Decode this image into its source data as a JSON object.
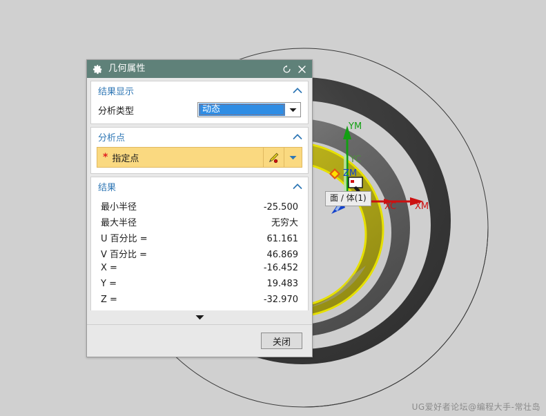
{
  "window": {
    "title": "几何属性",
    "gear_icon": "gear-icon",
    "reset_icon": "reset-icon",
    "close_icon": "close-icon"
  },
  "sections": {
    "result_display": {
      "header": "结果显示",
      "collapse_icon": "chevron-up-icon",
      "analysis_type_label": "分析类型",
      "analysis_type_value": "动态",
      "dropdown_icon": "chevron-down-icon"
    },
    "analysis_point": {
      "header": "分析点",
      "collapse_icon": "chevron-up-icon",
      "required_marker": "*",
      "field_label": "指定点",
      "point_constructor_icon": "point-constructor-icon",
      "dropdown_icon": "chevron-down-icon"
    },
    "results": {
      "header": "结果",
      "collapse_icon": "chevron-up-icon",
      "rows": [
        {
          "label": "最小半径",
          "value": "-25.500"
        },
        {
          "label": "最大半径",
          "value": "无穷大"
        },
        {
          "label": "U 百分比 =",
          "value": "61.161"
        },
        {
          "label": "V 百分比 =",
          "value": "46.869"
        },
        {
          "label": "X =",
          "value": "-16.452"
        },
        {
          "label": "Y =",
          "value": "19.483"
        },
        {
          "label": "Z =",
          "value": "-32.970"
        }
      ]
    }
  },
  "expander": {
    "icon": "chevron-down-icon"
  },
  "footer": {
    "close_label": "关闭"
  },
  "viewport": {
    "tooltip": "面 / 体(1)",
    "axes": [
      {
        "name": "XC",
        "color": "#c81010"
      },
      {
        "name": "XM",
        "color": "#c81010"
      },
      {
        "name": "YM",
        "color": "#108010"
      },
      {
        "name": "YC",
        "color": "#108010"
      },
      {
        "name": "ZM",
        "color": "#1040c8"
      }
    ]
  },
  "watermark": {
    "text": "UG爱好者论坛@编程大手-常壮岛"
  },
  "colors": {
    "titlebar": "#5f8179",
    "section_header_text": "#2f77b5",
    "selection_blue": "#2f8de4",
    "point_field_yellow": "#fad980",
    "highlight_edge_yellow": "#e0d800",
    "background": "#d0d0d0"
  }
}
